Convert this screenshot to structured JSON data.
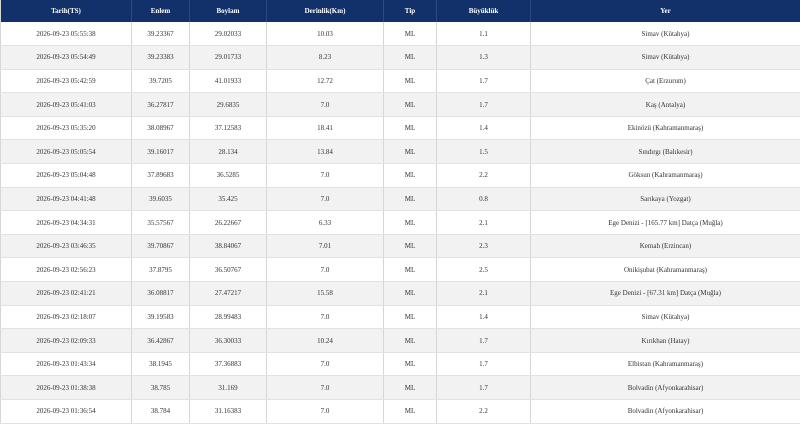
{
  "table": {
    "headers": [
      "Tarih(TS)",
      "Enlem",
      "Boylam",
      "Derinlik(Km)",
      "Tip",
      "Büyüklük",
      "Yer"
    ],
    "rows": [
      [
        "2026-09-23 05:55:38",
        "39.23367",
        "29.02033",
        "10.03",
        "ML",
        "1.1",
        "Simav (Kütahya)"
      ],
      [
        "2026-09-23 05:54:49",
        "39.23383",
        "29.01733",
        "8.23",
        "ML",
        "1.3",
        "Simav (Kütahya)"
      ],
      [
        "2026-09-23 05:42:59",
        "39.7205",
        "41.01933",
        "12.72",
        "ML",
        "1.7",
        "Çat (Erzurum)"
      ],
      [
        "2026-09-23 05:41:03",
        "36.27817",
        "29.6835",
        "7.0",
        "ML",
        "1.7",
        "Kaş (Antalya)"
      ],
      [
        "2026-09-23 05:35:20",
        "38.08967",
        "37.12583",
        "18.41",
        "ML",
        "1.4",
        "Ekinözü (Kahramanmaraş)"
      ],
      [
        "2026-09-23 05:05:54",
        "39.16017",
        "28.134",
        "13.84",
        "ML",
        "1.5",
        "Sındırgı (Balıkesir)"
      ],
      [
        "2026-09-23 05:04:48",
        "37.89683",
        "36.5285",
        "7.0",
        "ML",
        "2.2",
        "Göksun (Kahramanmaraş)"
      ],
      [
        "2026-09-23 04:41:48",
        "39.6035",
        "35.425",
        "7.0",
        "ML",
        "0.8",
        "Sarıkaya (Yozgat)"
      ],
      [
        "2026-09-23 04:34:31",
        "35.57567",
        "26.22667",
        "6.33",
        "ML",
        "2.1",
        "Ege Denizi - [165.77 km] Datça (Muğla)"
      ],
      [
        "2026-09-23 03:46:35",
        "39.70867",
        "38.84067",
        "7.01",
        "ML",
        "2.3",
        "Kemah (Erzincan)"
      ],
      [
        "2026-09-23 02:56:23",
        "37.8795",
        "36.50767",
        "7.0",
        "ML",
        "2.5",
        "Onikişubat (Kahramanmaraş)"
      ],
      [
        "2026-09-23 02:41:21",
        "36.08817",
        "27.47217",
        "15.58",
        "ML",
        "2.1",
        "Ege Denizi - [67.31 km] Datça (Muğla)"
      ],
      [
        "2026-09-23 02:18:07",
        "39.19583",
        "28.99483",
        "7.0",
        "ML",
        "1.4",
        "Simav (Kütahya)"
      ],
      [
        "2026-09-23 02:09:33",
        "36.42867",
        "36.30033",
        "10.24",
        "ML",
        "1.7",
        "Kırıkhan (Hatay)"
      ],
      [
        "2026-09-23 01:43:34",
        "38.1945",
        "37.36883",
        "7.0",
        "ML",
        "1.7",
        "Elbistan (Kahramanmaraş)"
      ],
      [
        "2026-09-23 01:38:38",
        "38.785",
        "31.169",
        "7.0",
        "ML",
        "1.7",
        "Bolvadin (Afyonkarahisar)"
      ],
      [
        "2026-09-23 01:36:54",
        "38.784",
        "31.16383",
        "7.0",
        "ML",
        "2.2",
        "Bolvadin (Afyonkarahisar)"
      ]
    ]
  },
  "colors": {
    "header_bg": "#12306a",
    "header_text": "#ffffff",
    "row_alt_bg": "#f2f2f2"
  }
}
